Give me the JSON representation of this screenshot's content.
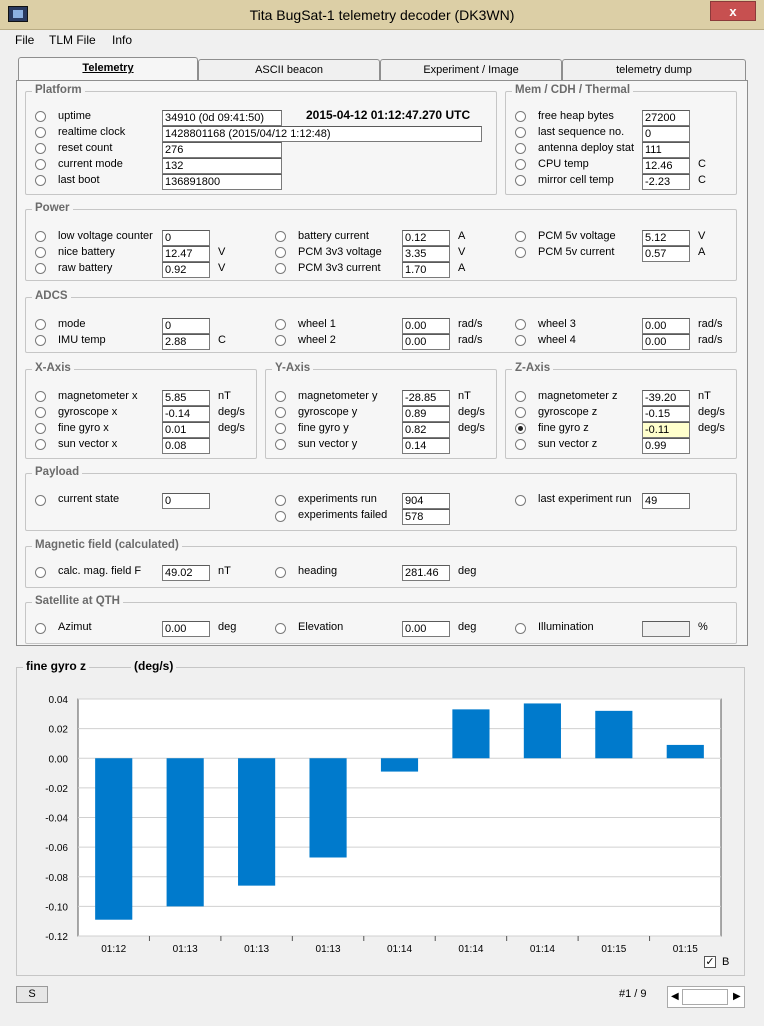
{
  "window": {
    "title": "Tita BugSat-1 telemetry decoder (DK3WN)",
    "close_glyph": "x",
    "icon": "app-icon"
  },
  "menu": [
    "File",
    "TLM File",
    "Info"
  ],
  "tabs": [
    "Telemetry",
    "ASCII beacon",
    "Experiment / Image",
    "telemetry dump"
  ],
  "platform": {
    "title": "Platform",
    "utc": "2015-04-12 01:12:47.270 UTC",
    "rows": [
      {
        "label": "uptime",
        "value": "34910  (0d 09:41:50)"
      },
      {
        "label": "realtime clock",
        "value": "1428801168  (2015/04/12 1:12:48)"
      },
      {
        "label": "reset count",
        "value": "276"
      },
      {
        "label": "current mode",
        "value": "132"
      },
      {
        "label": "last boot",
        "value": "136891800"
      }
    ]
  },
  "mem": {
    "title": "Mem / CDH / Thermal",
    "rows": [
      {
        "label": "free heap bytes",
        "value": "27200",
        "unit": ""
      },
      {
        "label": "last sequence no.",
        "value": "0",
        "unit": ""
      },
      {
        "label": "antenna deploy stat",
        "value": "111",
        "unit": ""
      },
      {
        "label": "CPU temp",
        "value": "12.46",
        "unit": "C"
      },
      {
        "label": "mirror cell temp",
        "value": "-2.23",
        "unit": "C"
      }
    ]
  },
  "power": {
    "title": "Power",
    "col1": [
      {
        "label": "low voltage counter",
        "value": "0",
        "unit": ""
      },
      {
        "label": "nice battery",
        "value": "12.47",
        "unit": "V"
      },
      {
        "label": "raw battery",
        "value": "0.92",
        "unit": "V"
      }
    ],
    "col2": [
      {
        "label": "battery current",
        "value": "0.12",
        "unit": "A"
      },
      {
        "label": "PCM 3v3 voltage",
        "value": "3.35",
        "unit": "V"
      },
      {
        "label": "PCM 3v3 current",
        "value": "1.70",
        "unit": "A"
      }
    ],
    "col3": [
      {
        "label": "PCM 5v voltage",
        "value": "5.12",
        "unit": "V"
      },
      {
        "label": "PCM 5v current",
        "value": "0.57",
        "unit": "A"
      }
    ]
  },
  "adcs": {
    "title": "ADCS",
    "col1": [
      {
        "label": "mode",
        "value": "0",
        "unit": ""
      },
      {
        "label": "IMU temp",
        "value": "2.88",
        "unit": "C"
      }
    ],
    "col2": [
      {
        "label": "wheel 1",
        "value": "0.00",
        "unit": "rad/s"
      },
      {
        "label": "wheel 2",
        "value": "0.00",
        "unit": "rad/s"
      }
    ],
    "col3": [
      {
        "label": "wheel 3",
        "value": "0.00",
        "unit": "rad/s"
      },
      {
        "label": "wheel 4",
        "value": "0.00",
        "unit": "rad/s"
      }
    ]
  },
  "xaxis": {
    "title": "X-Axis",
    "rows": [
      {
        "label": "magnetometer x",
        "value": "5.85",
        "unit": "nT"
      },
      {
        "label": "gyroscope x",
        "value": "-0.14",
        "unit": "deg/s"
      },
      {
        "label": "fine gyro x",
        "value": "0.01",
        "unit": "deg/s"
      },
      {
        "label": "sun vector x",
        "value": "0.08",
        "unit": ""
      }
    ]
  },
  "yaxis": {
    "title": "Y-Axis",
    "rows": [
      {
        "label": "magnetometer y",
        "value": "-28.85",
        "unit": "nT"
      },
      {
        "label": "gyroscope y",
        "value": "0.89",
        "unit": "deg/s"
      },
      {
        "label": "fine gyro y",
        "value": "0.82",
        "unit": "deg/s"
      },
      {
        "label": "sun vector y",
        "value": "0.14",
        "unit": ""
      }
    ]
  },
  "zaxis": {
    "title": "Z-Axis",
    "rows": [
      {
        "label": "magnetometer z",
        "value": "-39.20",
        "unit": "nT"
      },
      {
        "label": "gyroscope z",
        "value": "-0.15",
        "unit": "deg/s"
      },
      {
        "label": "fine gyro z",
        "value": "-0.11",
        "unit": "deg/s"
      },
      {
        "label": "sun vector z",
        "value": "0.99",
        "unit": ""
      }
    ]
  },
  "payload": {
    "title": "Payload",
    "current_state": {
      "label": "current state",
      "value": "0"
    },
    "experiments_run": {
      "label": "experiments run",
      "value": "904"
    },
    "experiments_failed": {
      "label": "experiments failed",
      "value": "578"
    },
    "last_experiment_run": {
      "label": "last experiment run",
      "value": "49"
    }
  },
  "magfield": {
    "title": "Magnetic field (calculated)",
    "calc": {
      "label": "calc. mag. field F",
      "value": "49.02",
      "unit": "nT"
    },
    "heading": {
      "label": "heading",
      "value": "281.46",
      "unit": "deg"
    }
  },
  "qth": {
    "title": "Satellite at QTH",
    "azimut": {
      "label": "Azimut",
      "value": "0.00",
      "unit": "deg"
    },
    "elevation": {
      "label": "Elevation",
      "value": "0.00",
      "unit": "deg"
    },
    "illumination": {
      "label": "Illumination",
      "value": "",
      "unit": "%"
    }
  },
  "chart_title": "fine gyro z",
  "chart_unit": "(deg/s)",
  "chart_data": {
    "type": "bar",
    "categories": [
      "01:12",
      "01:13",
      "01:13",
      "01:13",
      "01:14",
      "01:14",
      "01:14",
      "01:15",
      "01:15"
    ],
    "values": [
      -0.109,
      -0.1,
      -0.086,
      -0.067,
      -0.009,
      0.033,
      0.037,
      0.032,
      0.009
    ],
    "yticks": [
      "0.04",
      "0.02",
      "0.00",
      "-0.02",
      "-0.04",
      "-0.06",
      "-0.08",
      "-0.10",
      "-0.12"
    ],
    "ylim": [
      -0.12,
      0.04
    ],
    "grid": true,
    "color": "#007acc"
  },
  "footer": {
    "s_button": "S",
    "b_label": "B",
    "b_checked": "✓",
    "page": "#1 / 9",
    "scroll_left": "◀",
    "scroll_right": "▶"
  }
}
